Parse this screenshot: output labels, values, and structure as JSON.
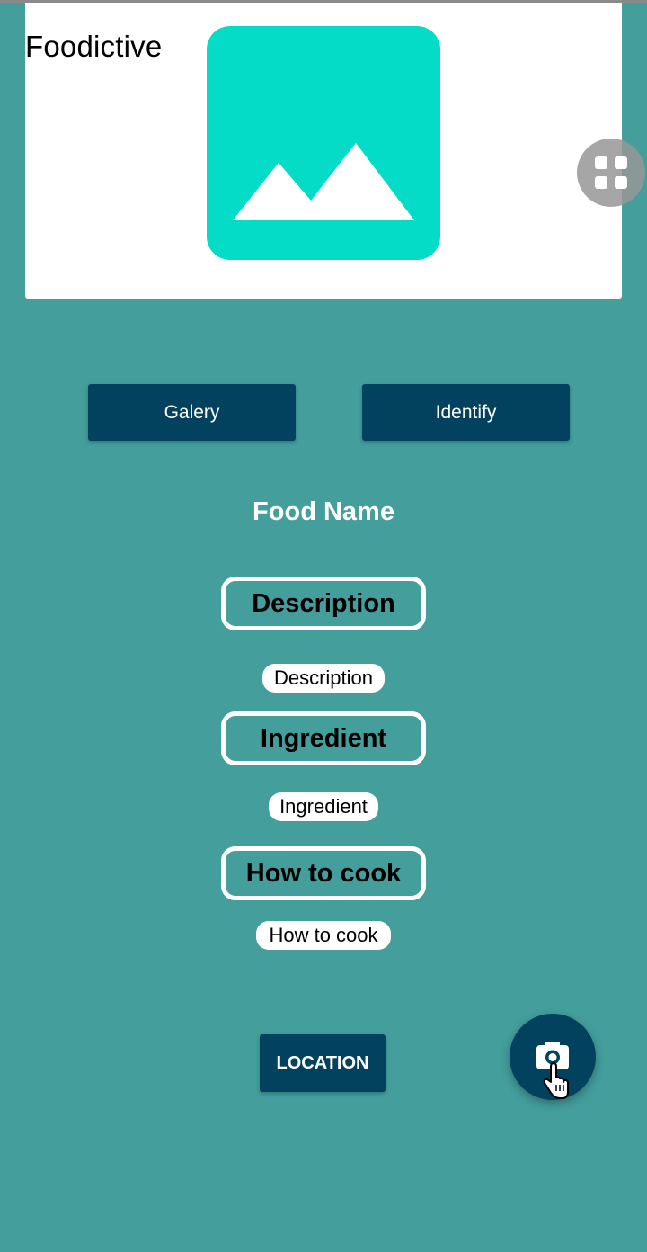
{
  "app": {
    "title": "Foodictive"
  },
  "buttons": {
    "gallery_label": "Galery",
    "identify_label": "Identify",
    "location_label": "LOCATION"
  },
  "food": {
    "name": "Food Name"
  },
  "sections": {
    "description": {
      "heading": "Description",
      "body": "Description"
    },
    "ingredient": {
      "heading": "Ingredient",
      "body": "Ingredient"
    },
    "how_to_cook": {
      "heading": "How to cook",
      "body": "How to cook"
    }
  },
  "icons": {
    "image_placeholder": "image-placeholder-icon",
    "floating_widget": "grid-icon",
    "camera": "camera-icon",
    "cursor": "hand-pointer-icon"
  },
  "colors": {
    "background": "#439e9c",
    "button": "#02425e",
    "placeholder": "#04dcc8",
    "card": "#ffffff"
  }
}
